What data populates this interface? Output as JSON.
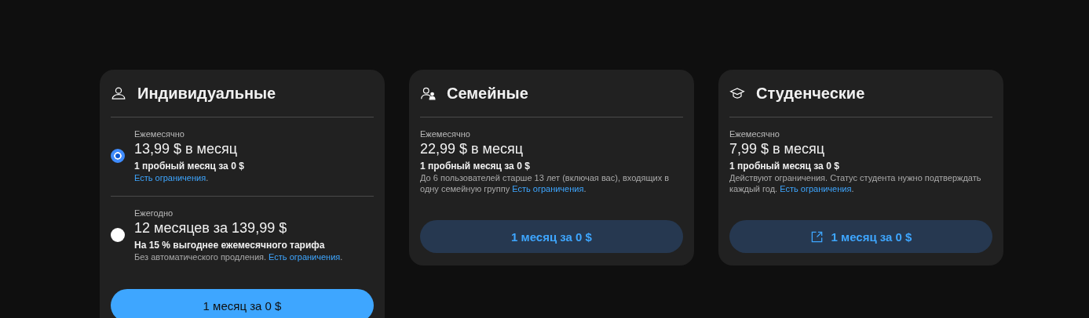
{
  "plans": [
    {
      "kind": "individual",
      "title": "Индивидуальные",
      "options": [
        {
          "period": "Ежемесячно",
          "price": "13,99 $ в месяц",
          "trial": "1 пробный месяц за 0 $",
          "link": "Есть ограничения",
          "link_suffix": ".",
          "selected": true
        },
        {
          "period": "Ежегодно",
          "price": "12 месяцев за 139,99 $",
          "trial": "На 15 % выгоднее ежемесячного тарифа",
          "note": "Без автоматического продления.",
          "link": "Есть ограничения",
          "link_suffix": ".",
          "selected": false
        }
      ],
      "button": {
        "label": "1 месяц за 0 $",
        "kind": "primary",
        "external": false
      }
    },
    {
      "kind": "family",
      "title": "Семейные",
      "options": [
        {
          "period": "Ежемесячно",
          "price": "22,99 $ в месяц",
          "trial": "1 пробный месяц за 0 $",
          "note": "До 6 пользователей старше 13 лет (включая вас), входящих в одну семейную группу",
          "link": "Есть ограничения",
          "link_suffix": "."
        }
      ],
      "button": {
        "label": "1 месяц за 0 $",
        "kind": "secondary",
        "external": false
      }
    },
    {
      "kind": "student",
      "title": "Студенческие",
      "options": [
        {
          "period": "Ежемесячно",
          "price": "7,99 $ в месяц",
          "trial": "1 пробный месяц за 0 $",
          "note": "Действуют ограничения. Статус студента нужно подтверждать каждый год.",
          "link": "Есть ограничения",
          "link_suffix": "."
        }
      ],
      "button": {
        "label": "1 месяц за 0 $",
        "kind": "secondary",
        "external": true
      }
    }
  ]
}
